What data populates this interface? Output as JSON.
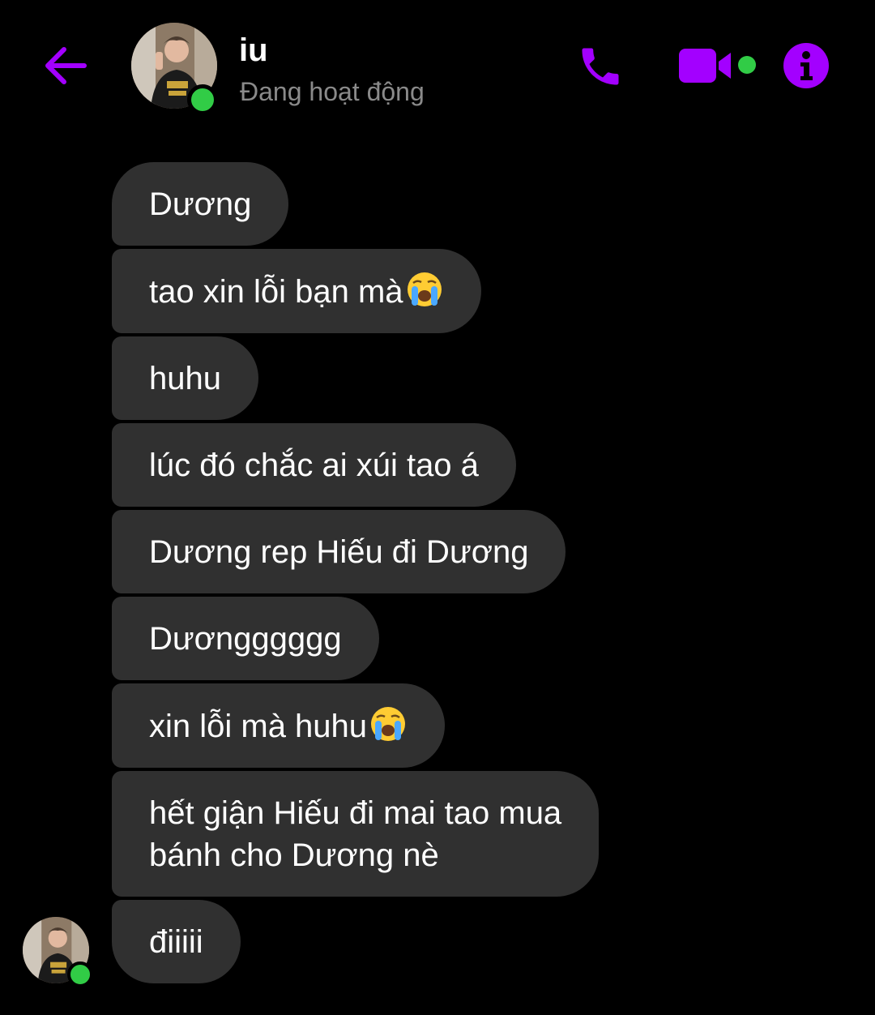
{
  "colors": {
    "accent": "#a300ff",
    "online": "#31cc46",
    "bubble": "#303030",
    "status_text": "#8a8a8a",
    "background": "#000000"
  },
  "header": {
    "name": "iu",
    "status": "Đang hoạt động",
    "icons": [
      "arrow-left-icon",
      "phone-icon",
      "video-camera-icon",
      "info-icon"
    ]
  },
  "messages": [
    {
      "text": "Dương"
    },
    {
      "text": "tao xin lỗi bạn mà",
      "emoji": "loudly-crying-face"
    },
    {
      "text": "huhu"
    },
    {
      "text": "lúc đó chắc ai xúi tao á"
    },
    {
      "text": "Dương rep Hiếu đi Dương"
    },
    {
      "text": "Dươngggggg"
    },
    {
      "text": "xin lỗi mà huhu",
      "emoji": "loudly-crying-face"
    },
    {
      "text": "hết giận Hiếu đi mai tao mua\nbánh cho Dương nè"
    },
    {
      "text": "điiiii"
    }
  ]
}
